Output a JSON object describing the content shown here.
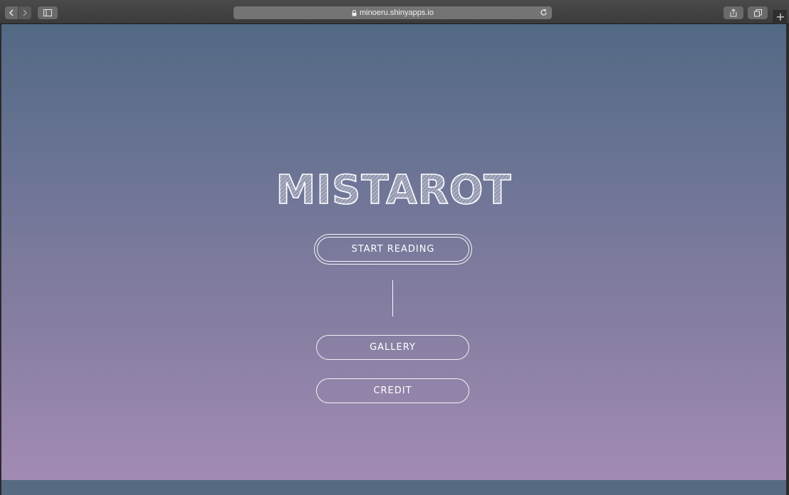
{
  "browser": {
    "url": "minoeru.shinyapps.io",
    "new_tab_symbol": "+",
    "icons": [
      "back-icon",
      "forward-icon",
      "sidebar-icon",
      "lock-icon",
      "reload-icon",
      "share-icon",
      "tabs-icon"
    ]
  },
  "app": {
    "logo_text": "MISTAROT",
    "start_label": "START READING",
    "gallery_label": "GALLERY",
    "credit_label": "CREDIT"
  },
  "colors": {
    "gradient_top": "#526984",
    "gradient_bottom": "#a28bb4",
    "button_border": "#ffffff",
    "footer": "#566a82"
  }
}
